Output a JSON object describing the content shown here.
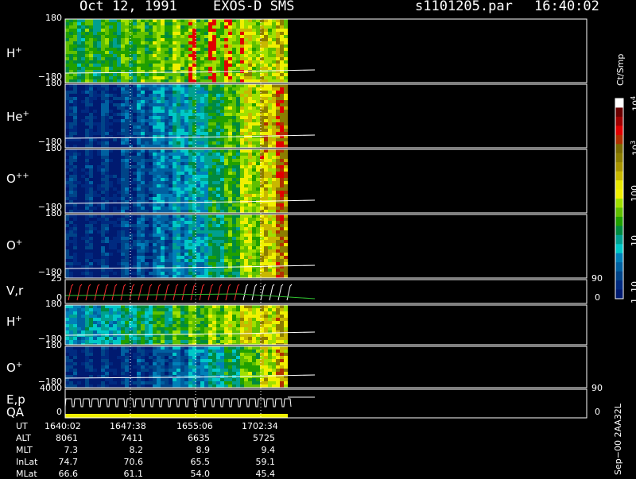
{
  "header": {
    "date": "Oct 12, 1991",
    "instrument": "EXOS-D SMS",
    "file": "s1101205.par",
    "time": "16:40:02"
  },
  "colorbar": {
    "unit": "Ct/Smp",
    "ticks": [
      "10",
      "10",
      "100",
      "10",
      "10",
      "1"
    ],
    "tick_exponents": [
      "4",
      "3",
      "",
      "",
      "",
      ""
    ],
    "colors": [
      "#ffffff",
      "#6b0000",
      "#a00000",
      "#e00000",
      "#b03000",
      "#7a6a00",
      "#8c7d00",
      "#a89400",
      "#c8b800",
      "#e8e800",
      "#f0f000",
      "#a0e000",
      "#60c000",
      "#20a000",
      "#008a40",
      "#00a090",
      "#00c8c8",
      "#0080b8",
      "#0060a0",
      "#004488",
      "#002a80",
      "#001a70"
    ]
  },
  "chart_data": {
    "type": "heatmap",
    "title": "Oct 12, 1991   EXOS-D SMS",
    "panels": [
      {
        "label": "H",
        "sup": "+",
        "ytop": "180",
        "ybot": "−180"
      },
      {
        "label": "He",
        "sup": "+",
        "ytop": "180",
        "ybot": "−180"
      },
      {
        "label": "O",
        "sup": "++",
        "ytop": "180",
        "ybot": "−180"
      },
      {
        "label": "O",
        "sup": "+",
        "ytop": "180",
        "ybot": "−180"
      },
      {
        "label": "V,r",
        "sup": "",
        "ytop": "25",
        "ybot": "0",
        "rtop": "90",
        "rbot": "0"
      },
      {
        "label": "H",
        "sup": "+",
        "ytop": "180",
        "ybot": "−180"
      },
      {
        "label": "O",
        "sup": "+",
        "ytop": "180",
        "ybot": "−180"
      },
      {
        "label": "E,p",
        "sup": "",
        "label2": "QA",
        "ytop": "4000",
        "ybot": "0",
        "rtop": "90",
        "rbot": "0"
      }
    ],
    "x_ticks": [
      "1640:02",
      "1647:38",
      "1655:06",
      "1702:34"
    ],
    "orbit_rows": [
      {
        "name": "UT",
        "values": [
          "1640:02",
          "1647:38",
          "1655:06",
          "1702:34"
        ]
      },
      {
        "name": "ALT",
        "values": [
          "8061",
          "7411",
          "6635",
          "5725"
        ]
      },
      {
        "name": "MLT",
        "values": [
          "7.3",
          "8.2",
          "8.9",
          "9.4"
        ]
      },
      {
        "name": "InLat",
        "values": [
          "74.7",
          "70.6",
          "65.5",
          "59.1"
        ]
      },
      {
        "name": "MLat",
        "values": [
          "66.6",
          "61.1",
          "54.0",
          "45.4"
        ]
      }
    ]
  },
  "footer": {
    "stamp": "Sep−00 2AA32L"
  }
}
